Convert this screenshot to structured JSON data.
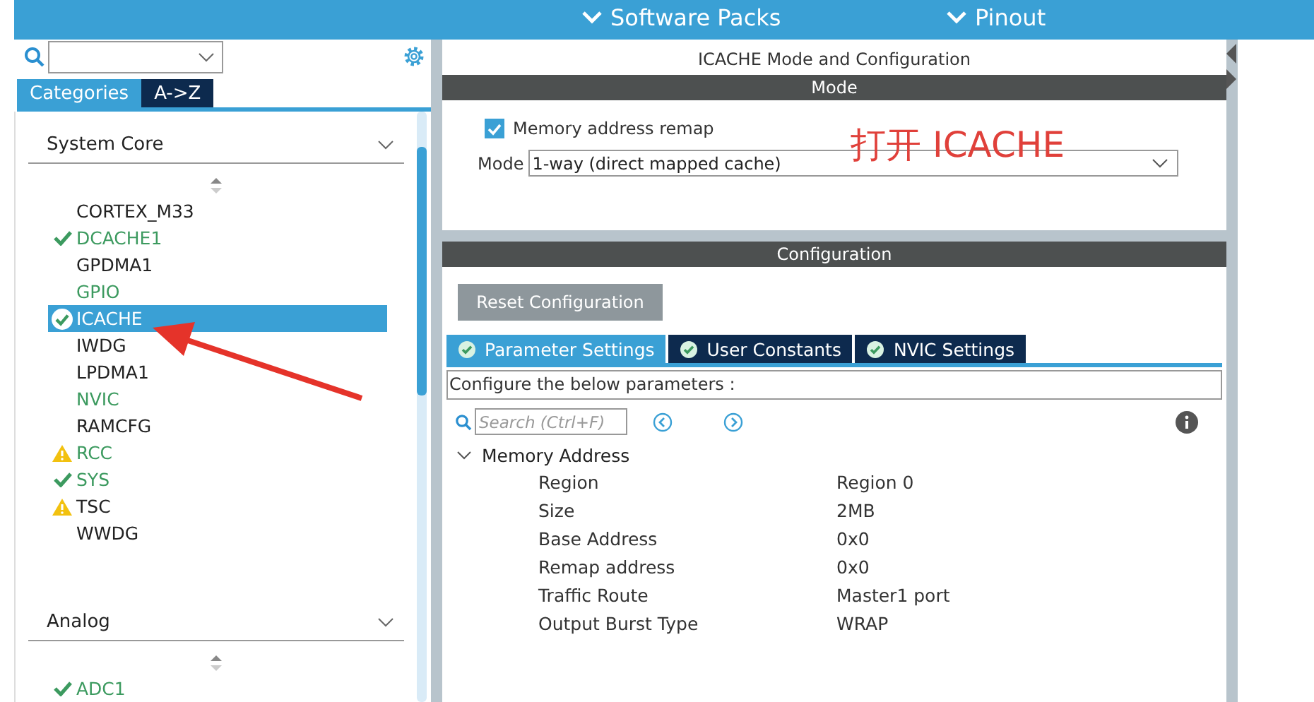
{
  "top_bar": {
    "items": [
      {
        "label": "Software Packs"
      },
      {
        "label": "Pinout"
      }
    ]
  },
  "sidebar": {
    "tabs": [
      {
        "label": "Categories",
        "selected": true
      },
      {
        "label": "A->Z",
        "selected": false
      }
    ],
    "categories": [
      {
        "title": "System Core",
        "items": [
          {
            "label": "CORTEX_M33",
            "kind": "plain",
            "configured": false,
            "selected": false
          },
          {
            "label": "DCACHE1",
            "kind": "ok",
            "configured": true,
            "selected": false
          },
          {
            "label": "GPDMA1",
            "kind": "plain",
            "configured": false,
            "selected": false
          },
          {
            "label": "GPIO",
            "kind": "plain",
            "configured": true,
            "selected": false
          },
          {
            "label": "ICACHE",
            "kind": "ok",
            "configured": true,
            "selected": true
          },
          {
            "label": "IWDG",
            "kind": "plain",
            "configured": false,
            "selected": false
          },
          {
            "label": "LPDMA1",
            "kind": "plain",
            "configured": false,
            "selected": false
          },
          {
            "label": "NVIC",
            "kind": "plain",
            "configured": true,
            "selected": false
          },
          {
            "label": "RAMCFG",
            "kind": "plain",
            "configured": false,
            "selected": false
          },
          {
            "label": "RCC",
            "kind": "warning",
            "configured": true,
            "selected": false
          },
          {
            "label": "SYS",
            "kind": "ok",
            "configured": true,
            "selected": false
          },
          {
            "label": "TSC",
            "kind": "warning",
            "configured": false,
            "selected": false
          },
          {
            "label": "WWDG",
            "kind": "plain",
            "configured": false,
            "selected": false
          }
        ]
      },
      {
        "title": "Analog",
        "items": [
          {
            "label": "ADC1",
            "kind": "ok",
            "configured": true,
            "selected": false
          }
        ]
      }
    ]
  },
  "main": {
    "title": "ICACHE Mode and Configuration",
    "mode_header": "Mode",
    "remap": {
      "label": "Memory address remap",
      "checked": true
    },
    "mode": {
      "label": "Mode",
      "value": "1-way (direct mapped cache)"
    },
    "config_header": "Configuration",
    "reset_button": "Reset Configuration",
    "tabs": [
      {
        "label": "Parameter Settings",
        "selected": true
      },
      {
        "label": "User Constants",
        "selected": false
      },
      {
        "label": "NVIC Settings",
        "selected": false
      }
    ],
    "hint": "Configure the below parameters :",
    "search": {
      "placeholder": "Search (Ctrl+F)"
    },
    "group": {
      "title": "Memory Address",
      "expanded": true,
      "rows": [
        {
          "name": "Region",
          "value": "Region 0"
        },
        {
          "name": "Size",
          "value": "2MB"
        },
        {
          "name": "Base Address",
          "value": "0x0"
        },
        {
          "name": "Remap address",
          "value": "0x0"
        },
        {
          "name": "Traffic Route",
          "value": "Master1 port"
        },
        {
          "name": "Output Burst Type",
          "value": "WRAP"
        }
      ]
    }
  },
  "annotation": {
    "text": "打开 ICACHE"
  }
}
